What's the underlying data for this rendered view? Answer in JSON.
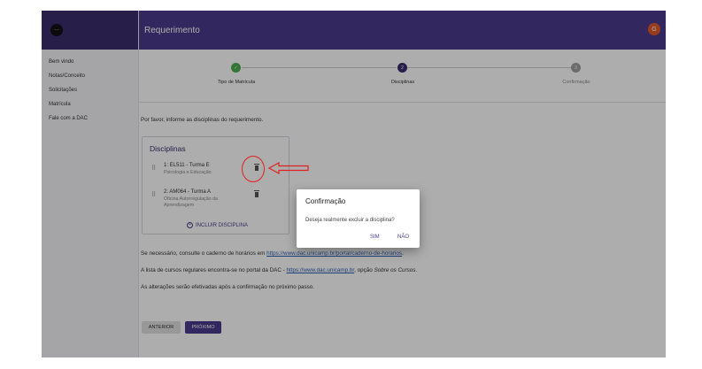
{
  "app": {
    "title": "Requerimento",
    "logo_text": "···",
    "user_initial": "G"
  },
  "sidebar": {
    "items": [
      {
        "label": "Bem vindo"
      },
      {
        "label": "Notas/Conceito"
      },
      {
        "label": "Solicitações"
      },
      {
        "label": "Matrícula"
      },
      {
        "label": "Fale com a DAC"
      }
    ]
  },
  "stepper": {
    "steps": [
      {
        "label": "Tipo de Matrícula",
        "state": "done",
        "marker": "✓"
      },
      {
        "label": "Disciplinas",
        "state": "active",
        "marker": "2"
      },
      {
        "label": "Confirmação",
        "state": "pending",
        "marker": "3"
      }
    ]
  },
  "main": {
    "intro": "Por favor, informe as disciplinas do requerimento.",
    "card_title": "Disciplinas",
    "disciplines": [
      {
        "code": "1: EL511 - Turma E",
        "name": "Psicologia e Educação"
      },
      {
        "code": "2: AM064 - Turma A",
        "name": "Oficina Autorregulação da Aprendizagem"
      }
    ],
    "include_label": "INCLUIR DISCIPLINA",
    "para1_prefix": "Se necessário, consulte o caderno de horários em ",
    "para1_link": "https://www.dac.unicamp.br/portal/caderno-de-horarios",
    "para1_suffix": ".",
    "para2_prefix": "A lista de cursos regulares encontra-se no portal da DAC - ",
    "para2_link": "https://www.dac.unicamp.br",
    "para2_middle": ", opção ",
    "para2_emph": "Sobre os Cursos",
    "para2_suffix": ".",
    "para3": "As alterações serão efetivadas após a confirmação no próximo passo.",
    "prev_label": "ANTERIOR",
    "next_label": "PRÓXIMO"
  },
  "dialog": {
    "title": "Confirmação",
    "message": "Deseja realmente excluir a disciplina?",
    "yes_label": "SIM",
    "no_label": "NÃO"
  },
  "icons": {
    "drag": "drag-handle-icon",
    "delete": "trash-icon",
    "add": "plus-circle-icon",
    "check": "check-icon"
  },
  "colors": {
    "brand": "#4a3c8c",
    "brand_dark": "#3a2d6e",
    "step_done": "#4caf50",
    "avatar": "#e0592a",
    "annotation": "#e02020"
  }
}
